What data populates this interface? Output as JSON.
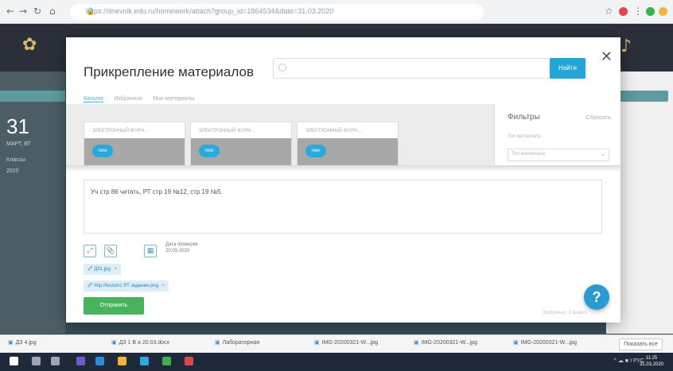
{
  "browser": {
    "url": "https://dnevnik.edu.ru/homework/attach?group_id=1864534&date=31.03.2020",
    "colors": {
      "ext1": "#e04848",
      "ext2": "#3bb04d",
      "ext3": "#f3b53a"
    }
  },
  "background_app": {
    "big_number": "31",
    "small_lines": [
      "МАРТ, ВТ",
      "Классы",
      "2020"
    ]
  },
  "modal": {
    "title": "Прикрепление материалов",
    "search_placeholder": "",
    "search_button": "Найти",
    "tabs": [
      {
        "label": "Каталог",
        "active": true
      },
      {
        "label": "Избранное",
        "active": false
      },
      {
        "label": "Мои материалы",
        "active": false
      }
    ],
    "cards": [
      {
        "label": "ЭЛЕКТРОННЫЙ ЖУРН...",
        "tag": "new"
      },
      {
        "label": "ЭЛЕКТРОННЫЙ ЖУРН...",
        "tag": "new"
      },
      {
        "label": "ЭЛЕКТРОННЫЙ ЖУРН...",
        "tag": "new"
      }
    ],
    "filters": {
      "title": "Фильтры",
      "reset": "Сбросить",
      "field_label": "Тип материала",
      "select_value": "Тип материала"
    },
    "homework_text": "Уч стр 86 читать, РТ стр 19 №12, стр 19 №5.",
    "due": {
      "label": "Дата проверки",
      "date": "20.03.2020"
    },
    "attachments": [
      {
        "name": "ДЗ1.jpg"
      },
      {
        "name": "http://lesson1 РТ задание.png"
      }
    ],
    "send_button": "Отправить",
    "footer_note": "Загружено: 2 файла",
    "colors": {
      "accent": "#25a4d6",
      "send": "#47b35c"
    }
  },
  "downloads": {
    "items": [
      "ДЗ 4.jpg",
      "ДЗ 1 В а 20.03.docx",
      "Лабораторная",
      "IMG-20200321-W...jpg",
      "IMG-20200321-W...jpg",
      "IMG-20200321-W...jpg"
    ],
    "show_all": "Показать все"
  },
  "taskbar": {
    "tray_text": "^ ☁ ■ Ⅰ РУС",
    "time": "11:25",
    "date": "31.03.2020"
  }
}
